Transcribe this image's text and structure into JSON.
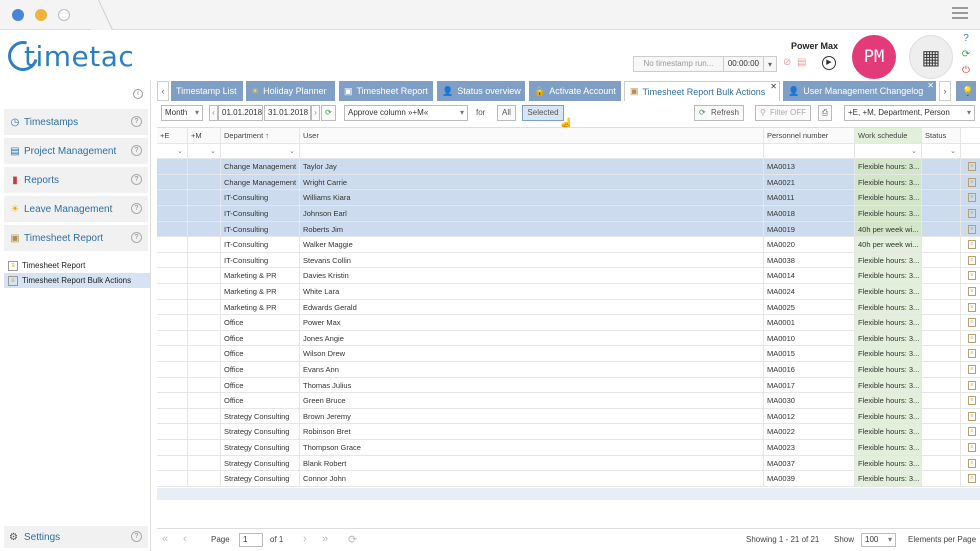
{
  "app": {
    "logo_text_a": "timetac",
    "user_name": "Power Max",
    "avatar_initials": "PM",
    "timestamp_text": "No timestamp run...",
    "timestamp_time": "00:00:00"
  },
  "sidebar": {
    "items": [
      {
        "label": "Timestamps",
        "icon": "clock-icon",
        "help": "?"
      },
      {
        "label": "Project Management",
        "icon": "clipboard-icon",
        "help": "?"
      },
      {
        "label": "Reports",
        "icon": "bar-chart-icon",
        "help": "?"
      },
      {
        "label": "Leave Management",
        "icon": "sun-icon",
        "help": "?"
      },
      {
        "label": "Timesheet Report",
        "icon": "timesheet-icon",
        "help": "?"
      }
    ],
    "sub_items": [
      {
        "label": "Timesheet Report"
      },
      {
        "label": "Timesheet Report Bulk Actions"
      }
    ],
    "settings_label": "Settings",
    "settings_help": "?"
  },
  "tabs": [
    {
      "label": "Timestamp List"
    },
    {
      "label": "Holiday Planner"
    },
    {
      "label": "Timesheet Report"
    },
    {
      "label": "Status overview"
    },
    {
      "label": "Activate Account"
    },
    {
      "label": "Timesheet Report Bulk Actions"
    },
    {
      "label": "User Management Changelog"
    }
  ],
  "toolbar": {
    "period": "Month",
    "date_from": "01.01.2018",
    "date_to": "31.01.2018",
    "action": "Approve column »+M«",
    "for_label": "for",
    "all_label": "All",
    "selected_label": "Selected",
    "refresh_label": "Refresh",
    "filter_label": "Filter OFF",
    "columns_select": "+E, +M, Department, Person"
  },
  "grid": {
    "columns": [
      "+E",
      "+M",
      "Department",
      "User",
      "Personnel number",
      "Work schedule",
      "Status"
    ],
    "rows": [
      {
        "department": "Change Management",
        "user": "Taylor Jay",
        "pn": "MA0013",
        "ws": "Flexible hours: 3...",
        "sel": true
      },
      {
        "department": "Change Management",
        "user": "Wright Carrie",
        "pn": "MA0021",
        "ws": "Flexible hours: 3...",
        "sel": true
      },
      {
        "department": "IT-Consulting",
        "user": "Williams Kiara",
        "pn": "MA0011",
        "ws": "Flexible hours: 3...",
        "sel": true
      },
      {
        "department": "IT-Consulting",
        "user": "Johnson Earl",
        "pn": "MA0018",
        "ws": "Flexible hours: 3...",
        "sel": true
      },
      {
        "department": "IT-Consulting",
        "user": "Roberts Jim",
        "pn": "MA0019",
        "ws": "40h per week wi...",
        "sel": true
      },
      {
        "department": "IT-Consulting",
        "user": "Walker Maggie",
        "pn": "MA0020",
        "ws": "40h per week wi...",
        "sel": false
      },
      {
        "department": "IT-Consulting",
        "user": "Stevans Collin",
        "pn": "MA0038",
        "ws": "Flexible hours: 3...",
        "sel": false
      },
      {
        "department": "Marketing & PR",
        "user": "Davies Kristin",
        "pn": "MA0014",
        "ws": "Flexible hours: 3...",
        "sel": false
      },
      {
        "department": "Marketing & PR",
        "user": "White Lara",
        "pn": "MA0024",
        "ws": "Flexible hours: 3...",
        "sel": false
      },
      {
        "department": "Marketing & PR",
        "user": "Edwards Gerald",
        "pn": "MA0025",
        "ws": "Flexible hours: 3...",
        "sel": false
      },
      {
        "department": "Office",
        "user": "Power Max",
        "pn": "MA0001",
        "ws": "Flexible hours: 3...",
        "sel": false
      },
      {
        "department": "Office",
        "user": "Jones Angie",
        "pn": "MA0010",
        "ws": "Flexible hours: 3...",
        "sel": false
      },
      {
        "department": "Office",
        "user": "Wilson Drew",
        "pn": "MA0015",
        "ws": "Flexible hours: 3...",
        "sel": false
      },
      {
        "department": "Office",
        "user": "Evans Ann",
        "pn": "MA0016",
        "ws": "Flexible hours: 3...",
        "sel": false
      },
      {
        "department": "Office",
        "user": "Thomas Julius",
        "pn": "MA0017",
        "ws": "Flexible hours: 3...",
        "sel": false
      },
      {
        "department": "Office",
        "user": "Green Bruce",
        "pn": "MA0030",
        "ws": "Flexible hours: 3...",
        "sel": false
      },
      {
        "department": "Strategy Consulting",
        "user": "Brown Jeremy",
        "pn": "MA0012",
        "ws": "Flexible hours: 3...",
        "sel": false
      },
      {
        "department": "Strategy Consulting",
        "user": "Robinson Bret",
        "pn": "MA0022",
        "ws": "Flexible hours: 3...",
        "sel": false
      },
      {
        "department": "Strategy Consulting",
        "user": "Thompson Grace",
        "pn": "MA0023",
        "ws": "Flexible hours: 3...",
        "sel": false
      },
      {
        "department": "Strategy Consulting",
        "user": "Blank Robert",
        "pn": "MA0037",
        "ws": "Flexible hours: 3...",
        "sel": false
      },
      {
        "department": "Strategy Consulting",
        "user": "Connor John",
        "pn": "MA0039",
        "ws": "Flexible hours: 3...",
        "sel": false
      }
    ]
  },
  "footer": {
    "page_label": "Page",
    "page_value": "1",
    "of_label": "of 1",
    "showing": "Showing 1 - 21 of 21",
    "show_label": "Show",
    "per_page": "100",
    "elements_label": "Elements per Page"
  },
  "colors": {
    "brand": "#2d7fc1",
    "tab": "#7f9fc6",
    "avatar": "#e33a78",
    "selected_row": "#ccdcee"
  }
}
